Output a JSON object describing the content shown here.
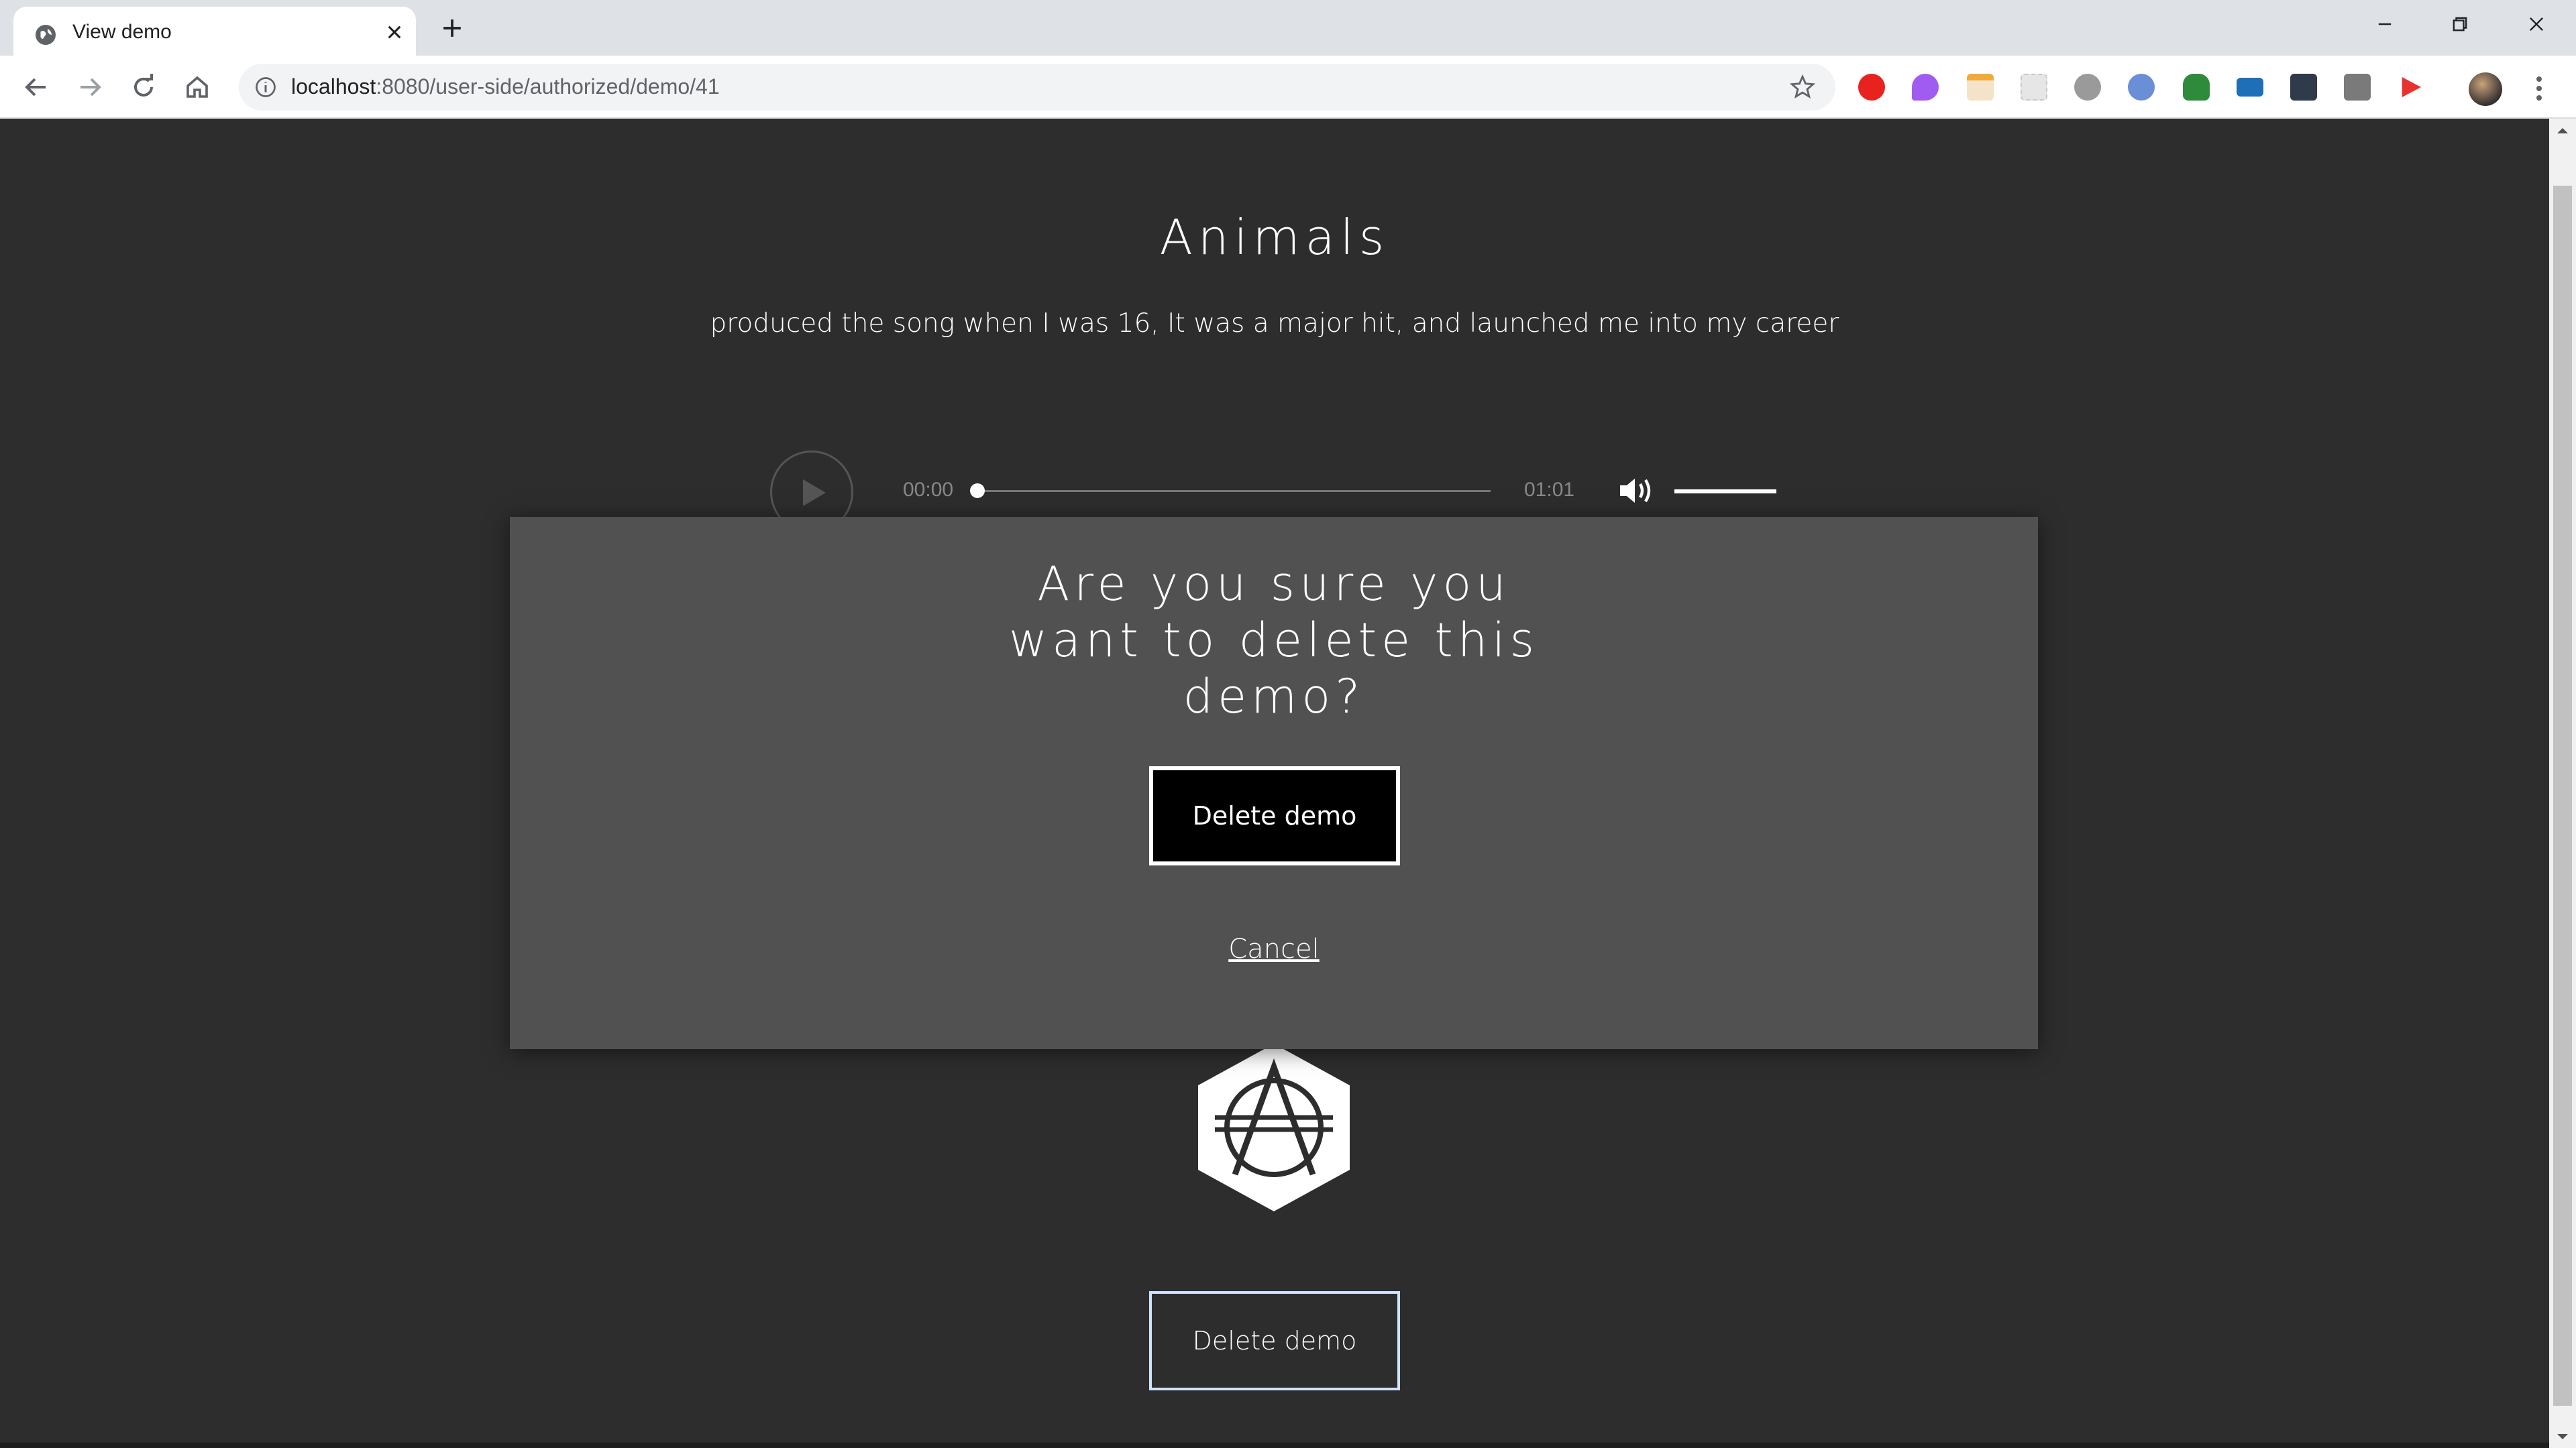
{
  "browser": {
    "tab_title": "View demo",
    "url_host": "localhost",
    "url_rest": ":8080/user-side/authorized/demo/41",
    "icons": [
      "globe-icon",
      "close-icon",
      "plus-icon",
      "back-icon",
      "forward-icon",
      "reload-icon",
      "home-icon",
      "info-icon",
      "star-icon",
      "menu-icon"
    ],
    "extension_colors": [
      "#e8231f",
      "#a05cf0",
      "#f2a93b",
      "#c8c8c8",
      "#777777",
      "#6b8fd6",
      "#2e8b3c",
      "#1e6fb8",
      "#2f3a4a",
      "#7a7a7a",
      "#e8322f"
    ]
  },
  "page": {
    "song_title": "Animals",
    "song_description": "produced the song when I was 16, It was a major hit, and launched me into my career",
    "player": {
      "current_time": "00:00",
      "duration": "01:01",
      "progress": 0,
      "volume": 1.0
    },
    "delete_button_label": "Delete demo"
  },
  "modal": {
    "title_lines": [
      "Are you sure you",
      "want to delete this",
      "demo?"
    ],
    "confirm_label": "Delete demo",
    "cancel_label": "Cancel"
  }
}
